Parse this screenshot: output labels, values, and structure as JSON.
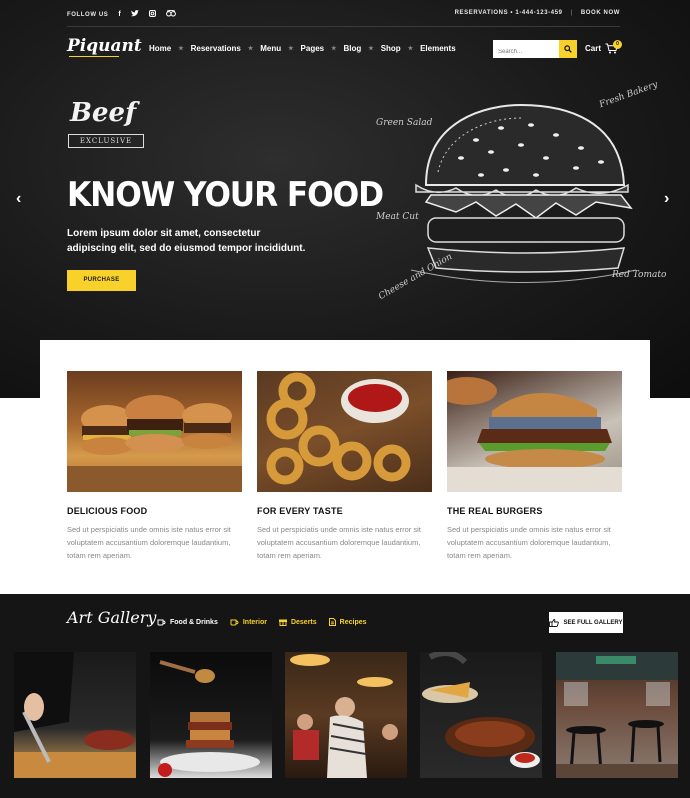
{
  "topbar": {
    "follow_label": "FOLLOW US",
    "social_icons": [
      "facebook-icon",
      "twitter-icon",
      "instagram-icon",
      "tripadvisor-icon"
    ],
    "reservations_label": "RESERVATIONS • 1-444-123-459",
    "book_label": "BOOK NOW"
  },
  "nav": {
    "logo": "Piquant",
    "items": [
      "Home",
      "Reservations",
      "Menu",
      "Pages",
      "Blog",
      "Shop",
      "Elements"
    ],
    "search_placeholder": "Search...",
    "cart_label": "Cart",
    "cart_count": "0"
  },
  "hero": {
    "badge_title": "Beef",
    "badge_sub": "EXCLUSIVE",
    "title": "KNOW YOUR FOOD",
    "text": "Lorem ipsum dolor sit amet, consectetur adipiscing elit, sed do eiusmod tempor incididunt.",
    "button": "PURCHASE",
    "chalk_labels": [
      "Green Salad",
      "Fresh Bakery",
      "Meat Cut",
      "Cheese and Onion",
      "Red Tomato"
    ]
  },
  "features": [
    {
      "title": "DELICIOUS FOOD",
      "text": "Sed ut perspiciatis unde omnis iste natus error sit voluptatem accusantium doloremque laudantium, totam rem aperiam."
    },
    {
      "title": "FOR EVERY TASTE",
      "text": "Sed ut perspiciatis unde omnis iste natus error sit voluptatem accusantium doloremque laudantium, totam rem aperiam."
    },
    {
      "title": "THE REAL BURGERS",
      "text": "Sed ut perspiciatis unde omnis iste natus error sit voluptatem accusantium doloremque laudantium, totam rem aperiam."
    }
  ],
  "gallery": {
    "title": "Art Gallery",
    "filters": [
      {
        "label": "Food & Drinks",
        "icon": "cup-icon",
        "active": true
      },
      {
        "label": "Interior",
        "icon": "cup-icon",
        "active": false
      },
      {
        "label": "Deserts",
        "icon": "gift-icon",
        "active": false
      },
      {
        "label": "Recipes",
        "icon": "document-icon",
        "active": false
      }
    ],
    "full_button": "SEE FULL GALLERY"
  },
  "colors": {
    "accent": "#f8d22a",
    "dark": "#151515"
  }
}
